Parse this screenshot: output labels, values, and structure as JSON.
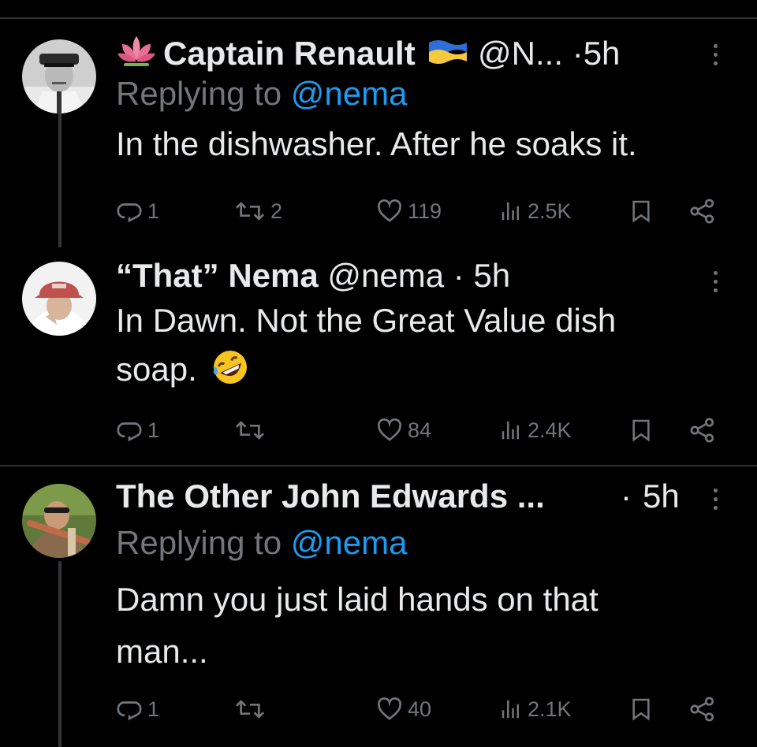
{
  "tweets": [
    {
      "name": "Captain Renault",
      "handle": "@N...",
      "time": "5h",
      "replying_label": "Replying to",
      "replying_to": "@nema",
      "text": "In the dishwasher. After he soaks it.",
      "stats": {
        "replies": "1",
        "reposts": "2",
        "likes": "119",
        "views": "2.5K"
      }
    },
    {
      "name": "“That” Nema",
      "handle": "@nema",
      "time": "5h",
      "text_line1": "In Dawn. Not the Great Value dish",
      "text_line2": "soap.",
      "stats": {
        "replies": "1",
        "reposts": "",
        "likes": "84",
        "views": "2.4K"
      }
    },
    {
      "name": "The Other John Edwards ...",
      "time": "5h",
      "replying_label": "Replying to",
      "replying_to": "@nema",
      "text_line1": "Damn you just laid hands on that",
      "text_line2": "man...",
      "stats": {
        "replies": "1",
        "reposts": "",
        "likes": "40",
        "views": "2.1K"
      }
    }
  ],
  "colors": {
    "background": "#000000",
    "text": "#e7e9ea",
    "muted": "#71767b",
    "link": "#1d9bf0",
    "divider": "#2f3336"
  },
  "icons": [
    "lotus-emoji-icon",
    "ukraine-flag-icon",
    "rofl-emoji-icon",
    "reply-icon",
    "repost-icon",
    "like-icon",
    "views-icon",
    "bookmark-icon",
    "share-icon",
    "more-icon"
  ]
}
